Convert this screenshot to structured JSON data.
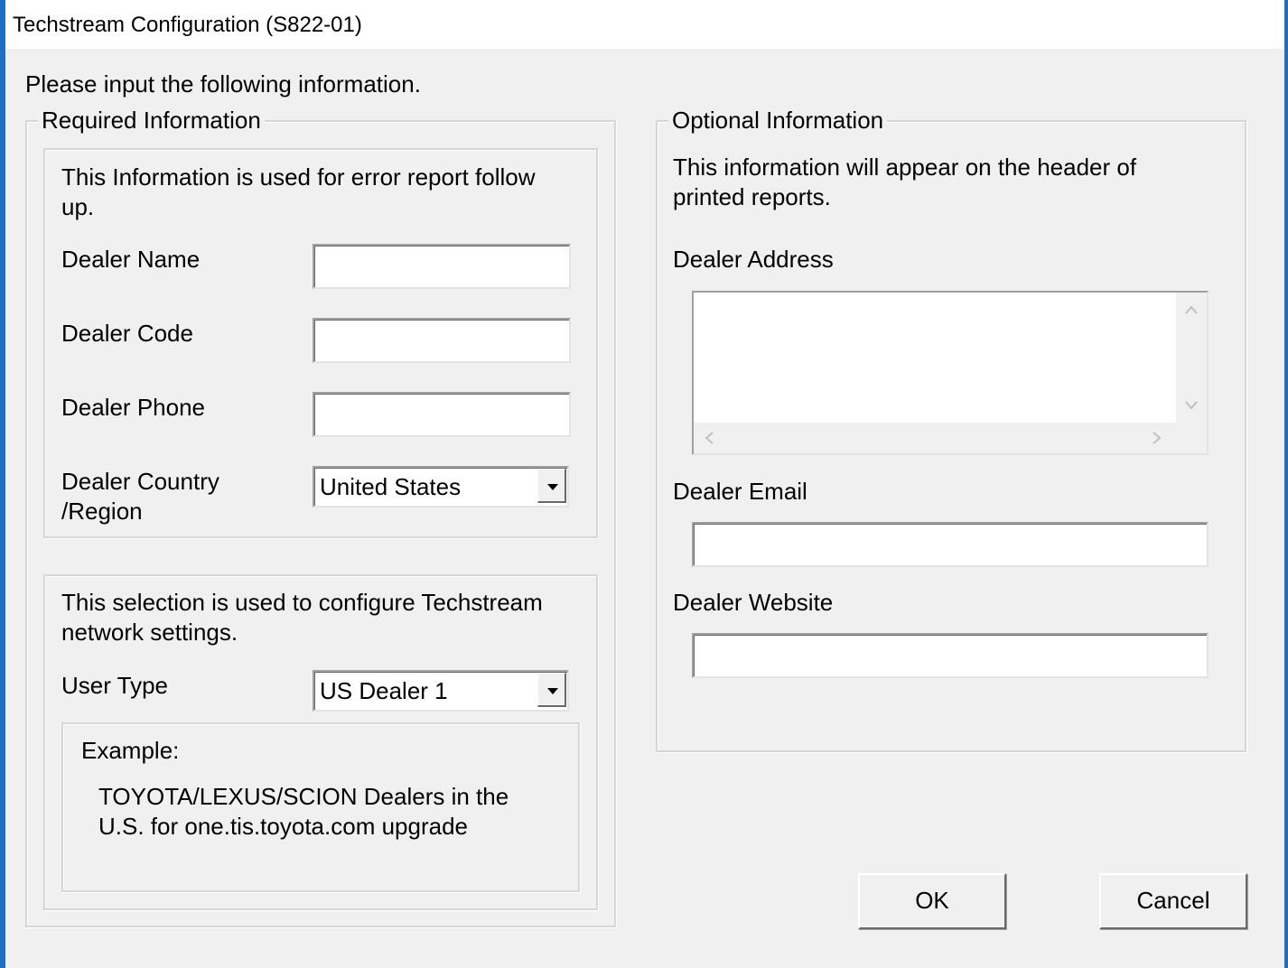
{
  "window": {
    "title": "Techstream Configuration (S822-01)"
  },
  "prompt": "Please input the following information.",
  "required": {
    "legend": "Required Information",
    "info_note": "This Information is used for error report follow up.",
    "fields": {
      "dealer_name_label": "Dealer Name",
      "dealer_name_value": "",
      "dealer_code_label": "Dealer Code",
      "dealer_code_value": "",
      "dealer_phone_label": "Dealer Phone",
      "dealer_phone_value": "",
      "dealer_country_label_1": "Dealer Country",
      "dealer_country_label_2": "/Region",
      "dealer_country_value": "United States"
    },
    "network": {
      "note": "This selection is used to configure Techstream network settings.",
      "user_type_label": "User Type",
      "user_type_value": "US Dealer 1",
      "example_title": "Example:",
      "example_text": "TOYOTA/LEXUS/SCION Dealers in the U.S. for one.tis.toyota.com upgrade"
    }
  },
  "optional": {
    "legend": "Optional Information",
    "note": "This information will appear on the header of printed reports.",
    "dealer_address_label": "Dealer Address",
    "dealer_address_value": "",
    "dealer_email_label": "Dealer Email",
    "dealer_email_value": "",
    "dealer_website_label": "Dealer Website",
    "dealer_website_value": ""
  },
  "buttons": {
    "ok": "OK",
    "cancel": "Cancel"
  },
  "icons": {
    "dropdown": "chevron-down-icon",
    "scroll_up": "chevron-up-icon",
    "scroll_down": "chevron-down-icon",
    "scroll_left": "chevron-left-icon",
    "scroll_right": "chevron-right-icon"
  }
}
